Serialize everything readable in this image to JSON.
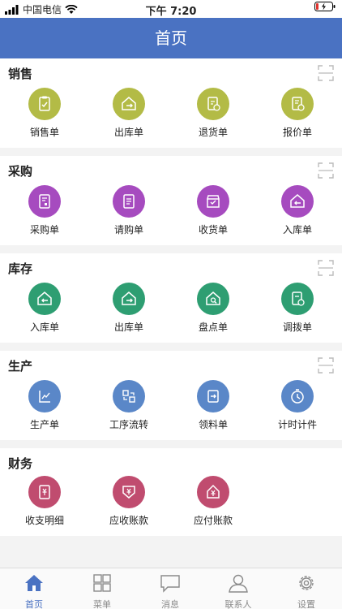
{
  "status_bar": {
    "carrier": "中国电信",
    "time": "下午 7:20"
  },
  "header": {
    "title": "首页"
  },
  "sections": [
    {
      "title": "销售",
      "color": "#b3bb46",
      "items": [
        {
          "label": "销售单",
          "icon": "clipboard-check-icon"
        },
        {
          "label": "出库单",
          "icon": "house-exit-icon"
        },
        {
          "label": "退货单",
          "icon": "return-document-icon"
        },
        {
          "label": "报价单",
          "icon": "quote-document-icon"
        }
      ]
    },
    {
      "title": "采购",
      "color": "#a64bbf",
      "items": [
        {
          "label": "采购单",
          "icon": "purchase-form-icon"
        },
        {
          "label": "请购单",
          "icon": "request-list-icon"
        },
        {
          "label": "收货单",
          "icon": "receive-box-icon"
        },
        {
          "label": "入库单",
          "icon": "house-enter-icon"
        }
      ]
    },
    {
      "title": "库存",
      "color": "#2e9e72",
      "items": [
        {
          "label": "入库单",
          "icon": "house-enter-icon"
        },
        {
          "label": "出库单",
          "icon": "house-exit-icon"
        },
        {
          "label": "盘点单",
          "icon": "house-search-icon"
        },
        {
          "label": "调拨单",
          "icon": "transfer-icon"
        }
      ]
    },
    {
      "title": "生产",
      "color": "#5a87c8",
      "items": [
        {
          "label": "生产单",
          "icon": "production-chart-icon"
        },
        {
          "label": "工序流转",
          "icon": "process-flow-icon"
        },
        {
          "label": "领料单",
          "icon": "material-pick-icon"
        },
        {
          "label": "计时计件",
          "icon": "timer-icon"
        }
      ]
    },
    {
      "title": "财务",
      "color": "#c04c6f",
      "items": [
        {
          "label": "收支明细",
          "icon": "money-detail-icon"
        },
        {
          "label": "应收账款",
          "icon": "receivable-icon"
        },
        {
          "label": "应付账款",
          "icon": "payable-icon"
        }
      ]
    }
  ],
  "tab_bar": {
    "active_color": "#4a72c2",
    "tabs": [
      {
        "label": "首页",
        "icon": "home-icon",
        "active": true
      },
      {
        "label": "菜单",
        "icon": "grid-menu-icon",
        "active": false
      },
      {
        "label": "消息",
        "icon": "message-icon",
        "active": false
      },
      {
        "label": "联系人",
        "icon": "contact-icon",
        "active": false
      },
      {
        "label": "设置",
        "icon": "settings-gear-icon",
        "active": false
      }
    ]
  }
}
